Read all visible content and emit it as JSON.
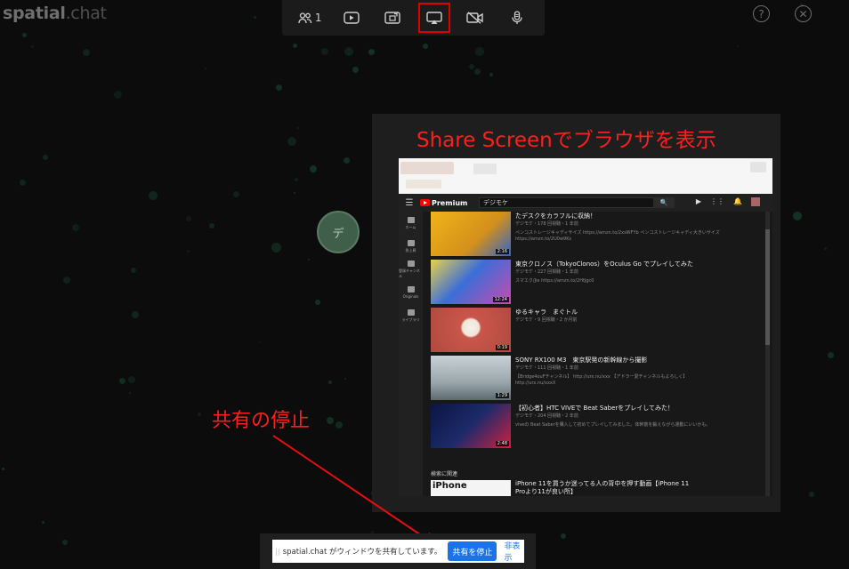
{
  "app": {
    "logo_main": "spatial",
    "logo_suffix": ".chat"
  },
  "topbar": {
    "participants_count": "1",
    "buttons": [
      {
        "icon": "participants-icon"
      },
      {
        "icon": "youtube-icon"
      },
      {
        "icon": "media-upload-icon"
      },
      {
        "icon": "screen-share-icon",
        "active": true
      },
      {
        "icon": "camera-off-icon"
      },
      {
        "icon": "mic-icon"
      }
    ]
  },
  "corner": {
    "help_label": "?",
    "close_label": "✕"
  },
  "avatar": {
    "initial": "デ"
  },
  "annotation": {
    "share_screen_title": "Share Screenでブラウザを表示",
    "stop_sharing_label": "共有の停止"
  },
  "youtube": {
    "brand": "Premium",
    "search_value": "デジモケ",
    "search_button": "🔍",
    "sidebar": [
      "ホーム",
      "急上昇",
      "登録チャンネル",
      "Originals",
      "ライブラリ"
    ],
    "videos": [
      {
        "title": "たデスクをカラフルに収納！",
        "meta": "デジモケ・178 回視聴・1 年前",
        "desc": "ペンコストレージキャディサイズ https://amzn.to/2xsWFYb ペンコストレージキャディ大きいサイズ",
        "desc2": "https://amzn.to/2U0w9Ks",
        "duration": "2:16",
        "thumb_color": "#e2a314"
      },
      {
        "title": "東京クロノス（TokyoClonos）をOculus Go でプレイしてみた",
        "meta": "デジモケ・227 回視聴・1 年前",
        "desc": "スマエク/Jie https://amzn.to/2HtJgc0",
        "desc2": "",
        "duration": "12:24",
        "thumb_color": "#3c6ed8"
      },
      {
        "title": "ゆるキャラ　まぐトル",
        "meta": "デジモケ・9 回視聴・2 か月前",
        "desc": "",
        "desc2": "",
        "duration": "0:19",
        "thumb_color": "#c9564a"
      },
      {
        "title": "SONY RX100 M3　東京駅発の新幹線から撮影",
        "meta": "デジモケ・111 回視聴・1 年前",
        "desc": "【Bridge4ouFチャンネル】 http://urx.nu/xxx 【アドラー愛チャンネルもよろしく】",
        "desc2": "http://urx.nu/xxxX",
        "duration": "1:29",
        "thumb_color": "#a9b4b8"
      },
      {
        "title": "【初心者】HTC VIVEで Beat Saberをプレイしてみた！",
        "meta": "デジモケ・204 回視聴・2 年前",
        "desc": "viveの Beat Saberを購入して初めてプレイしてみました。体幹筋を鍛えながら運動にいいかも。",
        "desc2": "",
        "duration": "2:48",
        "thumb_color": "#1c2a6a"
      }
    ],
    "related_heading": "検索に関連",
    "related_video": {
      "thumb_text": "iPhone",
      "title": "iPhone 11を買うか迷ってる人の背中を押す動画【iPhone 11 Proより11が良い所】"
    }
  },
  "sharebar": {
    "grip": "||",
    "message": "spatial.chat がウィンドウを共有しています。",
    "stop_button": "共有を停止",
    "hide_link": "非表示"
  }
}
